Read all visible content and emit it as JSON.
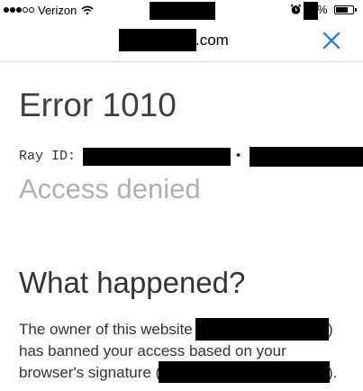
{
  "status_bar": {
    "carrier": "Verizon",
    "battery_text": "%"
  },
  "address_bar": {
    "domain_suffix": ".com"
  },
  "page": {
    "error_title": "Error 1010",
    "ray_id_label": "Ray ID:",
    "ray_separator": "•",
    "access_denied": "Access denied",
    "what_happened": "What happened?",
    "line1": "The owner of this website",
    "line1_end": ")",
    "line2": "has banned your access based on your",
    "line3": "browser's signature (",
    "line3_end": ")."
  },
  "icons": {
    "signal": "signal-dots-icon",
    "wifi": "wifi-icon",
    "alarm": "alarm-clock-icon",
    "battery": "battery-icon",
    "close": "close-icon"
  },
  "colors": {
    "accent": "#2a7fd4",
    "muted_text": "#b0b0b0"
  }
}
